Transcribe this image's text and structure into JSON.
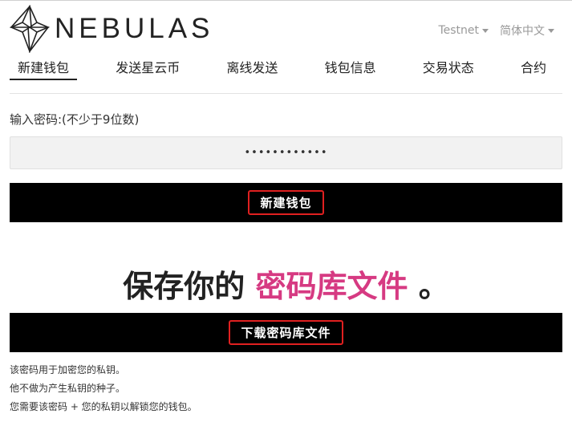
{
  "brand": {
    "name": "NEBULAS"
  },
  "header": {
    "network_label": "Testnet",
    "language_label": "简体中文"
  },
  "nav": [
    {
      "label": "新建钱包",
      "active": true
    },
    {
      "label": "发送星云币",
      "active": false
    },
    {
      "label": "离线发送",
      "active": false
    },
    {
      "label": "钱包信息",
      "active": false
    },
    {
      "label": "交易状态",
      "active": false
    },
    {
      "label": "合约",
      "active": false
    }
  ],
  "form": {
    "password_label": "输入密码:(不少于9位数)",
    "password_value": "••••••••••••",
    "create_button_label": "新建钱包"
  },
  "save": {
    "heading_prefix": "保存你的",
    "heading_highlight": "密码库文件",
    "heading_suffix": "。",
    "download_button_label": "下载密码库文件",
    "info_lines": [
      "该密码用于加密您的私钥。",
      "他不做为产生私钥的种子。",
      "您需要该密码 + 您的私钥以解锁您的钱包。"
    ]
  },
  "colors": {
    "accent_pink": "#d63a82",
    "highlight_red": "#e02020"
  }
}
